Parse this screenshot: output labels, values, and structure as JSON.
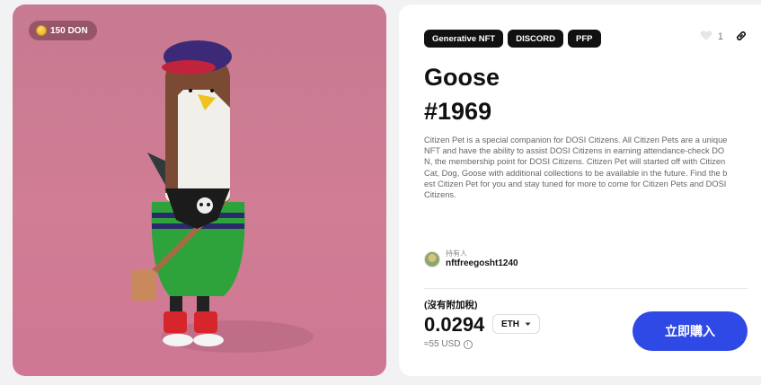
{
  "nft": {
    "badge_text": "150 DON",
    "tags": [
      "Generative NFT",
      "DISCORD",
      "PFP"
    ],
    "like_count": "1",
    "title_line1": "Goose",
    "title_line2": "#1969",
    "description": "Citizen Pet is a special companion for DOSI Citizens. All Citizen Pets are a unique NFT and have the ability to assist DOSI Citizens in earning attendance-check DON, the membership point for DOSI Citizens. Citizen Pet will started off with Citizen Cat, Dog, Goose with additional collections to be available in the future. Find the best Citizen Pet for you and stay tuned for more to come for Citizen Pets and DOSI Citizens."
  },
  "owner": {
    "label": "持有人",
    "name": "nftfreegosht1240"
  },
  "purchase": {
    "tax_note": "(沒有附加稅)",
    "price": "0.0294",
    "currency": "ETH",
    "usd_estimate": "≈55 USD",
    "buy_label": "立即購入"
  },
  "icons": {
    "coin": "coin-icon",
    "heart": "heart-icon",
    "link": "link-icon",
    "dropdown": "chevron-down-icon",
    "info": "info-icon"
  },
  "colors": {
    "art_background": "#c77a91",
    "buy_button": "#2f49e6",
    "tag_background": "#111111"
  }
}
